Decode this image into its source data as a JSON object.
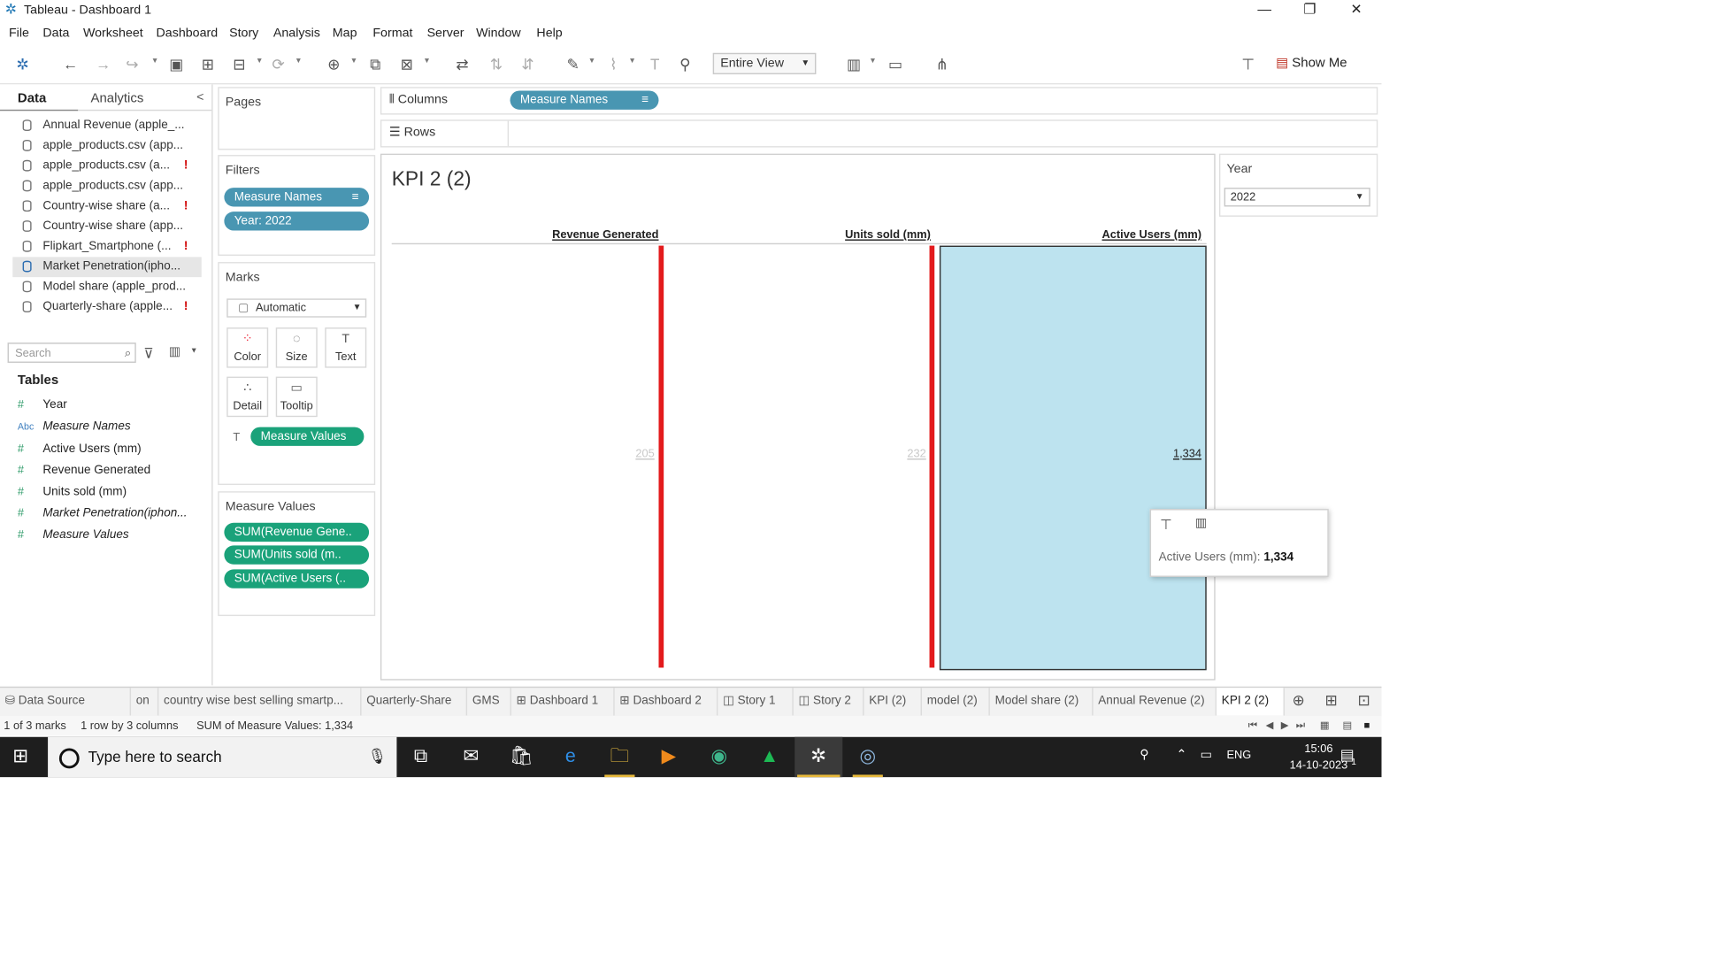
{
  "window": {
    "title": "Tableau - Dashboard 1"
  },
  "menu": [
    "File",
    "Data",
    "Worksheet",
    "Dashboard",
    "Story",
    "Analysis",
    "Map",
    "Format",
    "Server",
    "Window",
    "Help"
  ],
  "toolbar": {
    "fit": "Entire View",
    "show_me": "Show Me"
  },
  "side": {
    "tab_data": "Data",
    "tab_analytics": "Analytics",
    "collapse": "<",
    "sources": [
      {
        "label": "Annual Revenue (apple_...",
        "warn": ""
      },
      {
        "label": "apple_products.csv (app...",
        "warn": ""
      },
      {
        "label": "apple_products.csv (a...",
        "warn": "!"
      },
      {
        "label": "apple_products.csv (app...",
        "warn": ""
      },
      {
        "label": "Country-wise share (a...",
        "warn": "!"
      },
      {
        "label": "Country-wise share (app...",
        "warn": ""
      },
      {
        "label": "Flipkart_Smartphone (...",
        "warn": "!"
      },
      {
        "label": "Market Penetration(ipho...",
        "warn": ""
      },
      {
        "label": "Model share (apple_prod...",
        "warn": ""
      },
      {
        "label": "Quarterly-share (apple...",
        "warn": "!"
      }
    ],
    "search_placeholder": "Search",
    "tables_header": "Tables",
    "fields": [
      {
        "icon": "#",
        "label": "Year",
        "italic": false
      },
      {
        "icon": "Abc",
        "label": "Measure Names",
        "italic": true
      },
      {
        "icon": "#",
        "label": "Active Users (mm)",
        "italic": false
      },
      {
        "icon": "#",
        "label": "Revenue Generated",
        "italic": false
      },
      {
        "icon": "#",
        "label": "Units sold (mm)",
        "italic": false
      },
      {
        "icon": "#",
        "label": "Market Penetration(iphon...",
        "italic": true
      },
      {
        "icon": "#",
        "label": "Measure Values",
        "italic": true
      }
    ]
  },
  "cards": {
    "pages": "Pages",
    "filters": "Filters",
    "filter_pills": [
      "Measure Names",
      "Year: 2022"
    ],
    "marks": "Marks",
    "mark_type": "Automatic",
    "mark_buttons": [
      "Color",
      "Size",
      "Text",
      "Detail",
      "Tooltip"
    ],
    "marks_pill": "Measure Values",
    "measure_values": "Measure Values",
    "mv_pills": [
      "SUM(Revenue Gene..",
      "SUM(Units sold (m..",
      "SUM(Active Users (.."
    ]
  },
  "shelves": {
    "columns": "Columns",
    "columns_pill": "Measure Names",
    "rows": "Rows"
  },
  "view": {
    "title": "KPI 2 (2)"
  },
  "chart_data": {
    "type": "bar",
    "categories": [
      "Revenue Generated",
      "Units sold (mm)",
      "Active Users (mm)"
    ],
    "values": [
      205,
      232,
      1334
    ],
    "value_labels": [
      "205",
      "232",
      "1,334"
    ],
    "colors": [
      "#e31a1c",
      "#e31a1c",
      "#bde3ef"
    ],
    "highlight_index": 2,
    "title": "KPI 2 (2)",
    "xlabel": "",
    "ylabel": ""
  },
  "tooltip": {
    "label": "Active Users (mm):",
    "value": "1,334"
  },
  "year_filter": {
    "title": "Year",
    "value": "2022"
  },
  "sheet_tabs": [
    "Data Source",
    "on",
    "country wise best selling smartp...",
    "Quarterly-Share",
    "GMS",
    "Dashboard 1",
    "Dashboard 2",
    "Story 1",
    "Story 2",
    "KPI  (2)",
    "model (2)",
    "Model share (2)",
    "Annual Revenue (2)",
    "KPI 2 (2)"
  ],
  "status": {
    "marks": "1 of 3 marks",
    "shape": "1 row by 3 columns",
    "sum": "SUM of Measure Values: 1,334"
  },
  "taskbar": {
    "search": "Type here to search",
    "lang": "ENG",
    "time": "15:06",
    "date": "14-10-2023",
    "notif": "1"
  }
}
